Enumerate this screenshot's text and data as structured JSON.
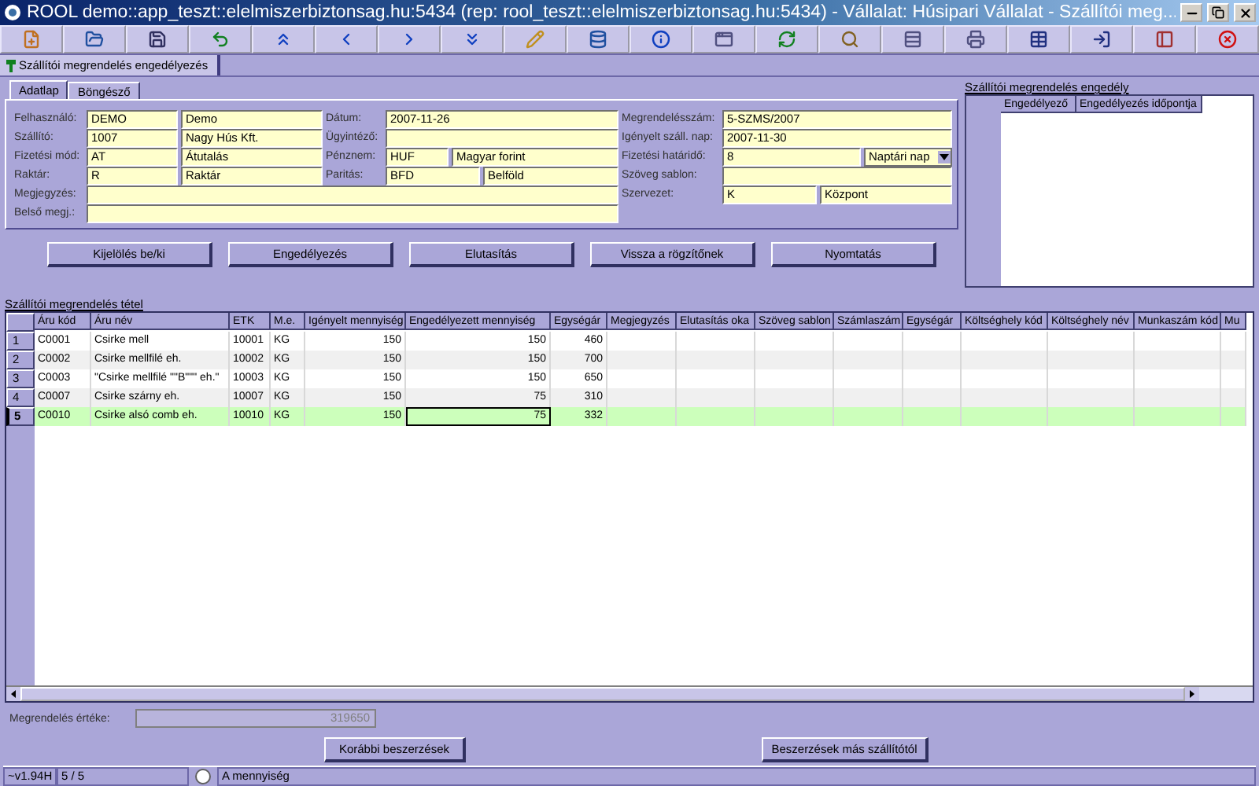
{
  "window": {
    "title": "ROOL demo::app_teszt::elelmiszerbiztonsag.hu:5434 (rep: rool_teszt::elelmiszerbiztonsag.hu:5434) - Vállalat: Húsipari Vállalat - Szállítói meg..."
  },
  "document_tab": {
    "label": "Szállítói megrendelés engedélyezés"
  },
  "form_tabs": [
    {
      "label": "Adatlap",
      "selected": true
    },
    {
      "label": "Böngésző",
      "selected": false
    }
  ],
  "form": {
    "left_column": [
      {
        "label": "Felhasználó:",
        "values": [
          "DEMO",
          "Demo"
        ]
      },
      {
        "label": "Szállító:",
        "values": [
          "1007",
          "Nagy Hús Kft."
        ]
      },
      {
        "label": "Fizetési mód:",
        "values": [
          "AT",
          "Átutalás"
        ]
      },
      {
        "label": "Raktár:",
        "values": [
          "R",
          "Raktár"
        ]
      }
    ],
    "middle_column": [
      {
        "label": "Dátum:",
        "values": [
          "2007-11-26"
        ]
      },
      {
        "label": "Ügyintéző:"
      },
      {
        "label": "Pénznem:",
        "values": [
          "HUF",
          "Magyar forint"
        ]
      },
      {
        "label": "Paritás:",
        "values": [
          "BFD",
          "Belföld"
        ]
      }
    ],
    "wide_rows": [
      {
        "label": "Megjegyzés:"
      },
      {
        "label": "Belső megj.:"
      }
    ],
    "right_column": [
      {
        "label": "Megrendelésszám:",
        "values": [
          "5-SZMS/2007"
        ]
      },
      {
        "label": "Igényelt száll. nap:",
        "values": [
          "2007-11-30"
        ]
      },
      {
        "label": "Fizetési határidő:",
        "values": [
          "8"
        ],
        "dropdown": "Naptári nap"
      },
      {
        "label": "Szöveg sablon:"
      },
      {
        "label": "Szervezet:",
        "values": [
          "K",
          "Központ"
        ]
      }
    ]
  },
  "action_buttons": [
    "Kijelölés be/ki",
    "Engedélyezés",
    "Elutasítás",
    "Vissza a rögzítőnek",
    "Nyomtatás"
  ],
  "approval_panel": {
    "title": "Szállítói megrendelés engedély",
    "columns": [
      "Engedélyező",
      "Engedélyezés időpontja"
    ]
  },
  "items": {
    "title": "Szállítói megrendelés tétel",
    "columns": [
      {
        "label": "Áru kód",
        "kind": "text"
      },
      {
        "label": "Áru név",
        "kind": "text"
      },
      {
        "label": "ETK",
        "kind": "text"
      },
      {
        "label": "M.e.",
        "kind": "text"
      },
      {
        "label": "Igényelt mennyiség",
        "kind": "number"
      },
      {
        "label": "Engedélyezett mennyiség",
        "kind": "number",
        "focus": true
      },
      {
        "label": "Egységár",
        "kind": "number"
      },
      {
        "label": "Megjegyzés",
        "kind": "text"
      },
      {
        "label": "Elutasítás oka",
        "kind": "text"
      },
      {
        "label": "Szöveg sablon",
        "kind": "text"
      },
      {
        "label": "Számlaszám",
        "kind": "text"
      },
      {
        "label": "Egységár",
        "kind": "number"
      },
      {
        "label": "Költséghely kód",
        "kind": "text"
      },
      {
        "label": "Költséghely név",
        "kind": "text"
      },
      {
        "label": "Munkaszám kód",
        "kind": "text"
      },
      {
        "label": "Mu",
        "kind": "text"
      }
    ],
    "rows": [
      {
        "number": "1",
        "selected": false,
        "cells": [
          "C0001",
          "Csirke mell",
          "10001",
          "KG",
          "150",
          "150",
          "460"
        ]
      },
      {
        "number": "2",
        "selected": false,
        "cells": [
          "C0002",
          "Csirke mellfilé eh.",
          "10002",
          "KG",
          "150",
          "150",
          "700"
        ]
      },
      {
        "number": "3",
        "selected": false,
        "cells": [
          "C0003",
          "\"Csirke mellfilé \"\"B\"\"\" eh.\"",
          "10003",
          "KG",
          "150",
          "150",
          "650"
        ]
      },
      {
        "number": "4",
        "selected": false,
        "cells": [
          "C0007",
          "Csirke szárny eh.",
          "10007",
          "KG",
          "150",
          "75",
          "310"
        ]
      },
      {
        "number": "5",
        "selected": true,
        "cells": [
          "C0010",
          "Csirke alsó comb eh.",
          "10010",
          "KG",
          "150",
          "75",
          "332"
        ]
      }
    ]
  },
  "order_value": {
    "label": "Megrendelés értéke:",
    "value": "319650"
  },
  "bottom_buttons": [
    "Korábbi beszerzések",
    "Beszerzések más szállítótól"
  ],
  "status_bar": {
    "version": "~v1.94H",
    "record": "5 / 5",
    "radio_label": "A mennyiség",
    "radio_checked": false
  }
}
